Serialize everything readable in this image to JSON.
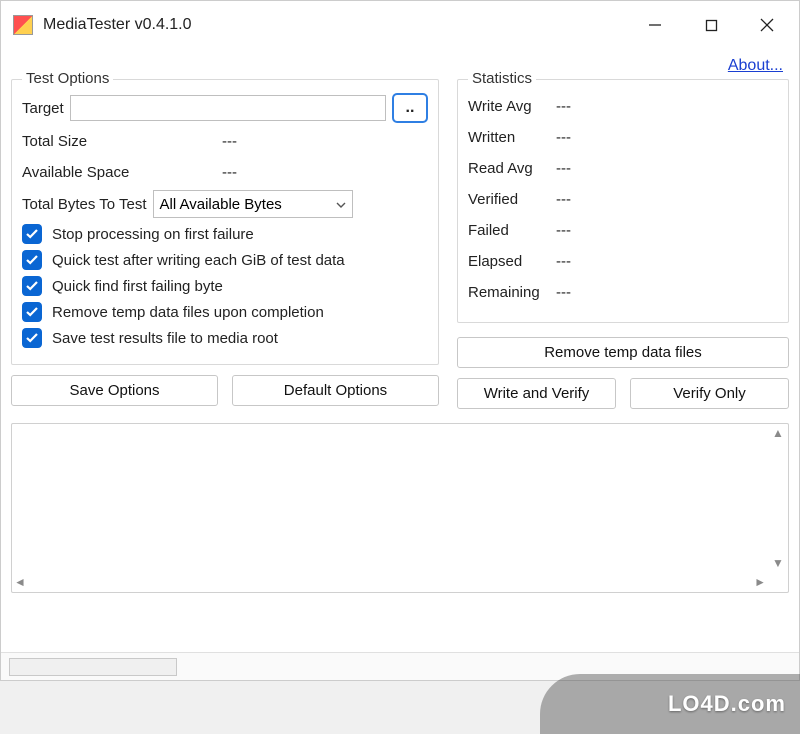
{
  "window_title": "MediaTester v0.4.1.0",
  "about_link": "About...",
  "test_options": {
    "legend": "Test Options",
    "target_label": "Target",
    "target_value": "",
    "browse_label": "..",
    "total_size_label": "Total Size",
    "total_size_value": "---",
    "available_space_label": "Available Space",
    "available_space_value": "---",
    "bytes_to_test_label": "Total Bytes To Test",
    "bytes_to_test_value": "All Available Bytes",
    "checks": [
      {
        "label": "Stop processing on first failure",
        "checked": true
      },
      {
        "label": "Quick test after writing each GiB of test data",
        "checked": true
      },
      {
        "label": "Quick find first failing byte",
        "checked": true
      },
      {
        "label": "Remove temp data files upon completion",
        "checked": true
      },
      {
        "label": "Save test results file to media root",
        "checked": true
      }
    ]
  },
  "statistics": {
    "legend": "Statistics",
    "rows": [
      {
        "label": "Write Avg",
        "value": "---"
      },
      {
        "label": "Written",
        "value": "---"
      },
      {
        "label": "Read Avg",
        "value": "---"
      },
      {
        "label": "Verified",
        "value": "---"
      },
      {
        "label": "Failed",
        "value": "---"
      },
      {
        "label": "Elapsed",
        "value": "---"
      },
      {
        "label": "Remaining",
        "value": "---"
      }
    ]
  },
  "buttons": {
    "save_options": "Save Options",
    "default_options": "Default Options",
    "remove_temp": "Remove temp data files",
    "write_verify": "Write and Verify",
    "verify_only": "Verify Only"
  },
  "watermark": "LO4D.com"
}
